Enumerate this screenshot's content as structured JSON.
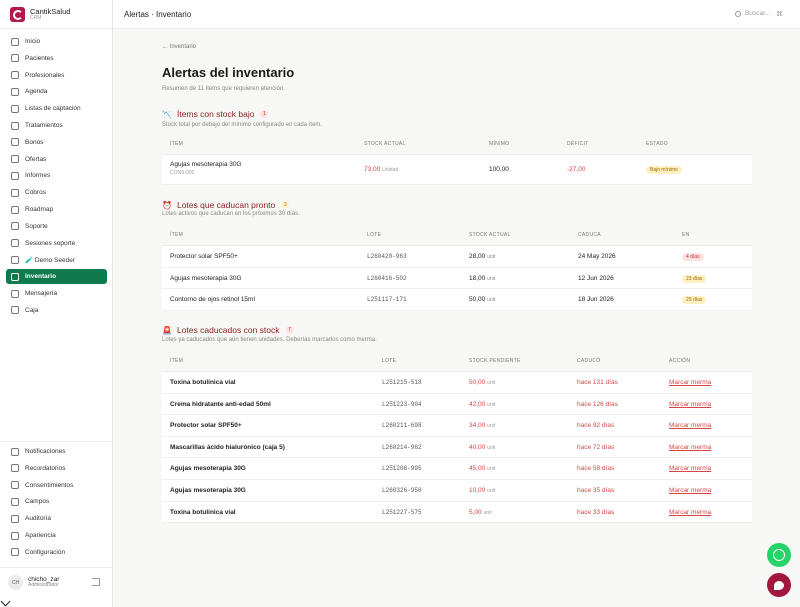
{
  "brand": {
    "name": "CantikSalud",
    "sub": "CRM"
  },
  "sidebar": {
    "items": [
      {
        "label": "Inicio",
        "icon": "home-icon"
      },
      {
        "label": "Pacientes",
        "icon": "users-icon"
      },
      {
        "label": "Profesionales",
        "icon": "professionals-icon"
      },
      {
        "label": "Agenda",
        "icon": "calendar-icon"
      },
      {
        "label": "Listas de captación",
        "icon": "list-icon"
      },
      {
        "label": "Tratamientos",
        "icon": "treatment-icon"
      },
      {
        "label": "Bonos",
        "icon": "ticket-icon"
      },
      {
        "label": "Ofertas",
        "icon": "tag-icon"
      },
      {
        "label": "Informes",
        "icon": "report-icon"
      },
      {
        "label": "Cobros",
        "icon": "payment-icon"
      },
      {
        "label": "Roadmap",
        "icon": "roadmap-icon"
      },
      {
        "label": "Soporte",
        "icon": "support-icon"
      },
      {
        "label": "Sesiones soporte",
        "icon": "sessions-icon"
      },
      {
        "label": "🧪 Demo Seeder",
        "icon": "seeder-icon"
      },
      {
        "label": "Inventario",
        "icon": "box-icon",
        "active": true
      },
      {
        "label": "Mensajería",
        "icon": "message-icon"
      },
      {
        "label": "Caja",
        "icon": "cash-icon"
      }
    ],
    "bottom_items": [
      {
        "label": "Notificaciones",
        "icon": "bell-icon"
      },
      {
        "label": "Recordatorios",
        "icon": "clock-icon"
      },
      {
        "label": "Consentimientos",
        "icon": "document-icon"
      },
      {
        "label": "Campos",
        "icon": "fields-icon"
      },
      {
        "label": "Auditoría",
        "icon": "audit-icon"
      },
      {
        "label": "Apariencia",
        "icon": "palette-icon"
      },
      {
        "label": "Configuración",
        "icon": "gear-icon"
      }
    ],
    "user": {
      "initials": "CH",
      "name": "chicho_zar",
      "role": "Administrador"
    }
  },
  "header": {
    "breadcrumb": "Alertas · Inventario",
    "search_placeholder": "Buscar...",
    "shortcut": "⌘"
  },
  "page": {
    "back_link": "← Inventario",
    "title": "Alertas del inventario",
    "summary": "Resumen de 11 ítems que requieren atención."
  },
  "low_stock": {
    "icon": "📉",
    "title": "Ítems con stock bajo",
    "count": "1",
    "description": "Stock total por debajo del mínimo configurado en cada ítem.",
    "headers": [
      "ÍTEM",
      "STOCK ACTUAL",
      "MÍNIMO",
      "DÉFICIT",
      "ESTADO"
    ],
    "rows": [
      {
        "item": "Agujas mesoterapia 30G",
        "sku": "CONS-002",
        "stock": "73,00",
        "unit": "Unidad",
        "min": "100,00",
        "deficit": "-27,00",
        "status": "Bajo mínimo"
      }
    ]
  },
  "expiring": {
    "icon": "⏰",
    "title": "Lotes que caducan pronto",
    "count": "3",
    "description": "Lotes activos que caducan en los próximos 30 días.",
    "headers": [
      "ÍTEM",
      "LOTE",
      "STOCK ACTUAL",
      "CADUCA",
      "EN"
    ],
    "rows": [
      {
        "item": "Protector solar SPF50+",
        "lot": "L260420-963",
        "stock": "28,00",
        "unit": "unit",
        "expires": "24 May 2026",
        "in": "4 días",
        "urgent": true
      },
      {
        "item": "Agujas mesoterapia 30G",
        "lot": "L260416-502",
        "stock": "18,00",
        "unit": "unit",
        "expires": "12 Jun 2026",
        "in": "23 días",
        "urgent": false
      },
      {
        "item": "Contorno de ojos retinol 15ml",
        "lot": "L251117-171",
        "stock": "50,00",
        "unit": "unit",
        "expires": "18 Jun 2026",
        "in": "29 días",
        "urgent": false
      }
    ]
  },
  "expired": {
    "icon": "🚨",
    "title": "Lotes caducados con stock",
    "count": "7",
    "description": "Lotes ya caducados que aún tienen unidades. Deberías marcarlos como merma.",
    "headers": [
      "ÍTEM",
      "LOTE",
      "STOCK PENDIENTE",
      "CADUCÓ",
      "ACCIÓN"
    ],
    "action_label": "Marcar merma",
    "rows": [
      {
        "item": "Toxina botulínica vial",
        "lot": "L251215-518",
        "stock": "50,00",
        "unit": "unit",
        "expired": "hace 131 días"
      },
      {
        "item": "Crema hidratante anti-edad 50ml",
        "lot": "L251223-904",
        "stock": "42,00",
        "unit": "unit",
        "expired": "hace 126 días"
      },
      {
        "item": "Protector solar SPF50+",
        "lot": "L260211-698",
        "stock": "34,00",
        "unit": "unit",
        "expired": "hace 92 días"
      },
      {
        "item": "Mascarillas ácido hialurónico (caja 5)",
        "lot": "L260214-962",
        "stock": "40,00",
        "unit": "unit",
        "expired": "hace 72 días"
      },
      {
        "item": "Agujas mesoterapia 30G",
        "lot": "L251206-995",
        "stock": "45,00",
        "unit": "unit",
        "expired": "hace 58 días"
      },
      {
        "item": "Agujas mesoterapia 30G",
        "lot": "L260326-950",
        "stock": "10,00",
        "unit": "unit",
        "expired": "hace 35 días"
      },
      {
        "item": "Toxina botulínica vial",
        "lot": "L251227-575",
        "stock": "5,00",
        "unit": "unit",
        "expired": "hace 33 días"
      }
    ]
  },
  "colors": {
    "accent": "#0f7a4e",
    "brand": "#b5174f",
    "danger": "#d64545",
    "section_title": "#8e2222",
    "whatsapp": "#25d366"
  }
}
